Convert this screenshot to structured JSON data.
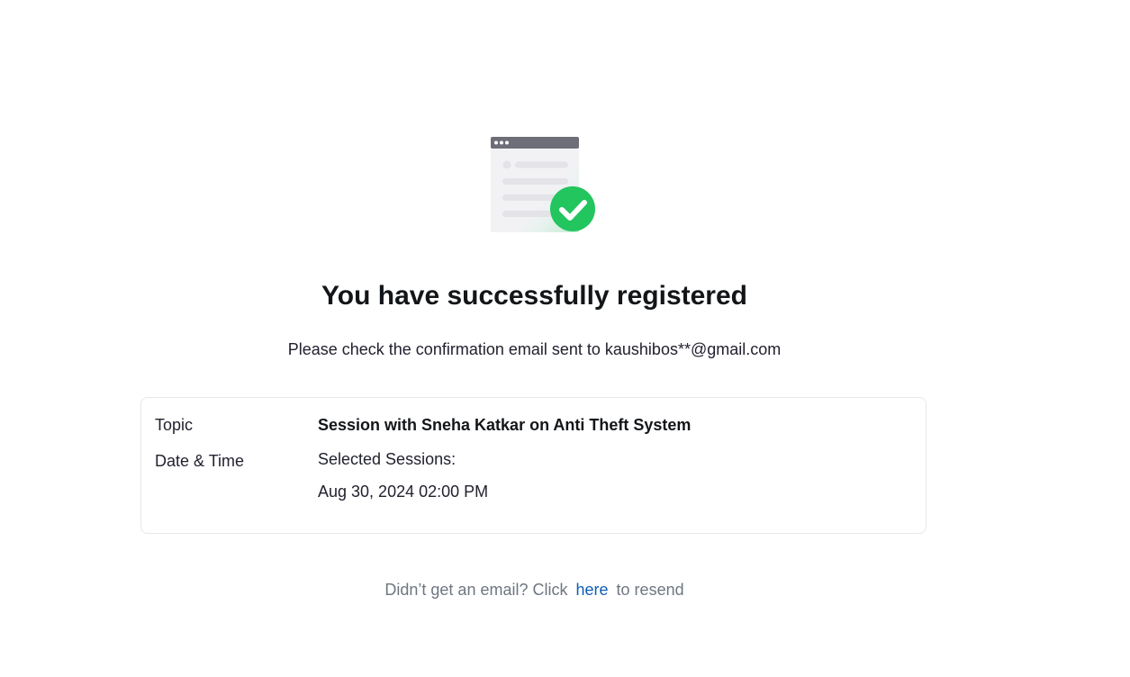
{
  "confirmation": {
    "title": "You have successfully registered",
    "message": "Please check the confirmation email sent to kaushibos**@gmail.com"
  },
  "details": {
    "topic_label": "Topic",
    "topic_value": "Session with Sneha Katkar on Anti Theft System",
    "datetime_label": "Date & Time",
    "sessions_heading": "Selected Sessions:",
    "session_time": "Aug 30, 2024 02:00 PM"
  },
  "resend": {
    "prefix": "Didn’t get an email? Click",
    "link_label": "here",
    "suffix": "to resend"
  },
  "colors": {
    "success_green": "#22c55e",
    "link_blue": "#0e5eb5",
    "window_bar": "#6e6e78"
  },
  "icons": {
    "illustration": "browser-window-with-checkmark-icon"
  }
}
